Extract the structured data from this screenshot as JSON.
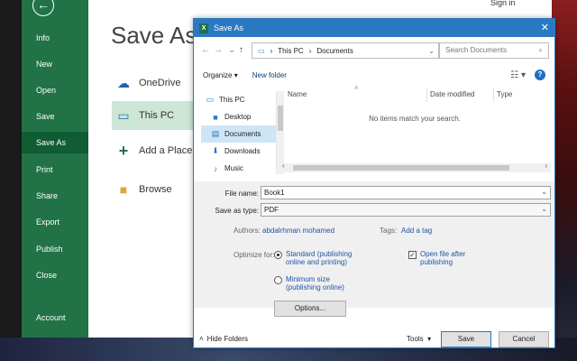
{
  "backstage": {
    "title": "Save As",
    "sign_in": "Sign in",
    "back_icon": "arrow-left-icon",
    "menu": [
      "Info",
      "New",
      "Open",
      "Save",
      "Save As",
      "Print",
      "Share",
      "Export",
      "Publish",
      "Close",
      "Account"
    ],
    "active_menu": "Save As",
    "locations": [
      {
        "label": "OneDrive",
        "icon": "cloud-icon"
      },
      {
        "label": "This PC",
        "icon": "computer-icon"
      },
      {
        "label": "Add a Place",
        "icon": "plus-icon"
      },
      {
        "label": "Browse",
        "icon": "folder-icon"
      }
    ],
    "active_location": "This PC"
  },
  "dialog": {
    "title": "Save As",
    "breadcrumb": [
      "This PC",
      "Documents"
    ],
    "search_placeholder": "Search Documents",
    "organize_label": "Organize",
    "new_folder_label": "New folder",
    "tree": [
      "This PC",
      "Desktop",
      "Documents",
      "Downloads",
      "Music"
    ],
    "active_tree": "Documents",
    "columns": [
      "Name",
      "Date modified",
      "Type"
    ],
    "empty_message": "No items match your search.",
    "file_name_label": "File name:",
    "file_name": "Book1",
    "save_type_label": "Save as type:",
    "save_type": "PDF",
    "authors_label": "Authors:",
    "authors_value": "abdalrhman mohamed",
    "tags_label": "Tags:",
    "tags_value": "Add a tag",
    "optimize_label": "Optimize for:",
    "opt_standard_1": "Standard (publishing",
    "opt_standard_2": "online and printing)",
    "opt_minimum_1": "Minimum size",
    "opt_minimum_2": "(publishing online)",
    "open_after_1": "Open file after",
    "open_after_2": "publishing",
    "options_label": "Options...",
    "hide_folders_label": "Hide Folders",
    "tools_label": "Tools",
    "save_label": "Save",
    "cancel_label": "Cancel"
  },
  "colors": {
    "excel_green": "#217346",
    "dialog_blue": "#2b79c2"
  }
}
